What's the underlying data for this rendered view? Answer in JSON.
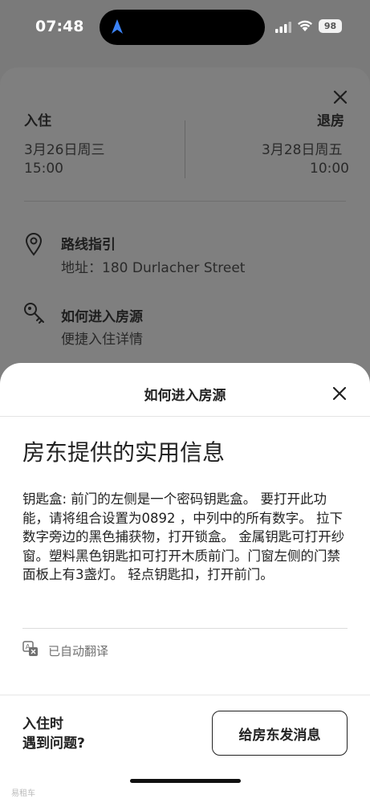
{
  "status_bar": {
    "time": "07:48",
    "battery": "98"
  },
  "background": {
    "checkin_label": "入住",
    "checkout_label": "退房",
    "checkin_date": "3月26日周三",
    "checkin_time": "15:00",
    "checkout_date": "3月28日周五",
    "checkout_time": "10:00",
    "directions_title": "路线指引",
    "directions_address": "地址：180 Durlacher Street",
    "access_title": "如何进入房源",
    "access_sub": "便捷入住详情"
  },
  "modal": {
    "title": "如何进入房源",
    "headline": "房东提供的实用信息",
    "body": "钥匙盒: 前门的左侧是一个密码钥匙盒。 要打开此功能，请将组合设置为0892 ，中列中的所有数字。 拉下数字旁边的黑色捕获物，打开锁盒。 金属钥匙可打开纱窗。塑料黑色钥匙扣可打开木质前门。门窗左侧的门禁面板上有3盏灯。 轻点钥匙扣，打开前门。",
    "translated_label": "已自动翻译",
    "footer_question_line1": "入住时",
    "footer_question_line2": "遇到问题?",
    "message_button": "给房东发消息"
  },
  "watermark": "易租车",
  "icons": {
    "nav_arrow": "location-arrow-icon",
    "close": "close-icon",
    "pin": "map-pin-icon",
    "key": "key-icon",
    "translate": "translate-icon"
  }
}
